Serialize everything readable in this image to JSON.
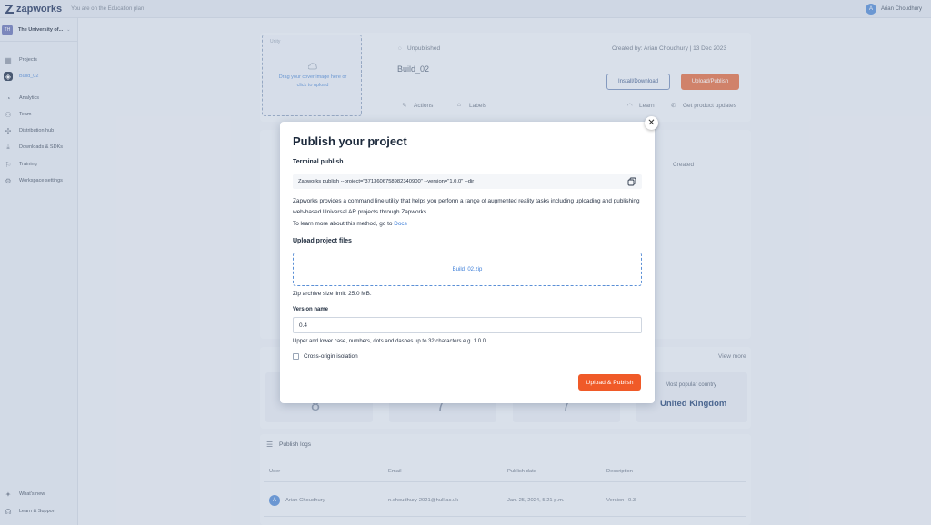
{
  "topbar": {
    "logo": "zapworks",
    "plan_text": "You are on the Education plan",
    "user_initial": "A",
    "user_name": "Arian Choudhury"
  },
  "sidebar": {
    "org_initials": "TH",
    "org_name": "The University of...",
    "items": [
      {
        "label": "Projects",
        "icon": "grid-icon"
      },
      {
        "label": "Build_02",
        "icon": "unity-icon"
      },
      {
        "label": "Analytics",
        "icon": "chart-icon"
      },
      {
        "label": "Team",
        "icon": "team-icon"
      },
      {
        "label": "Distribution hub",
        "icon": "distribution-icon"
      },
      {
        "label": "Downloads & SDKs",
        "icon": "download-icon"
      },
      {
        "label": "Training",
        "icon": "training-icon"
      },
      {
        "label": "Workspace settings",
        "icon": "settings-icon"
      }
    ],
    "bottom_items": [
      {
        "label": "What's new",
        "icon": "news-icon"
      },
      {
        "label": "Learn & Support",
        "icon": "support-icon"
      }
    ]
  },
  "project": {
    "dropzone_tag": "Unity",
    "dropzone_text_1": "Drag your cover image here or",
    "dropzone_text_2": "click to upload",
    "status": "Unpublished",
    "created_by": "Created by: Arian Choudhury | 13 Dec 2023",
    "title": "Build_02",
    "install_label": "Install/Download",
    "upload_label": "Upload/Publish",
    "actions_label": "Actions",
    "labels_label": "Labels",
    "learn_label": "Learn",
    "updates_label": "Get product updates"
  },
  "background": {
    "created_header": "Created",
    "view_more": "View more",
    "popular_country_label": "Most popular country",
    "popular_country_value": "United Kingdom",
    "stat_values": [
      "8",
      "7",
      "7"
    ],
    "logs_title": "Publish logs",
    "log_columns": [
      "User",
      "Email",
      "Publish date",
      "Description"
    ],
    "log_row": {
      "initial": "A",
      "user": "Arian Choudhury",
      "email": "n.choudhury-2021@hull.ac.uk",
      "date": "Jan. 25, 2024, 5:21 p.m.",
      "description": "Version | 0.3"
    }
  },
  "modal": {
    "title": "Publish your project",
    "terminal_heading": "Terminal publish",
    "command": "Zapworks publish --project=\"3713606758982340900\" --version=\"1.0.0\" --dir .",
    "description": "Zapworks provides a command line utility that helps you perform a range of augmented reality tasks including uploading and publishing web-based Universal AR projects through Zapworks.",
    "learn_more_prefix": "To learn more about this method, go to",
    "docs_link": "Docs",
    "upload_heading": "Upload project files",
    "uploaded_file": "Build_02.zip",
    "size_limit": "Zip archive size limit: 25.0 MB.",
    "version_label": "Version name",
    "version_value": "0.4",
    "version_hint": "Upper and lower case, numbers, dots and dashes up to 32 characters e.g. 1.0.0",
    "cross_origin_label": "Cross-origin isolation",
    "cross_origin_checked": false,
    "publish_button": "Upload & Publish",
    "accent_color": "#f05a28"
  }
}
